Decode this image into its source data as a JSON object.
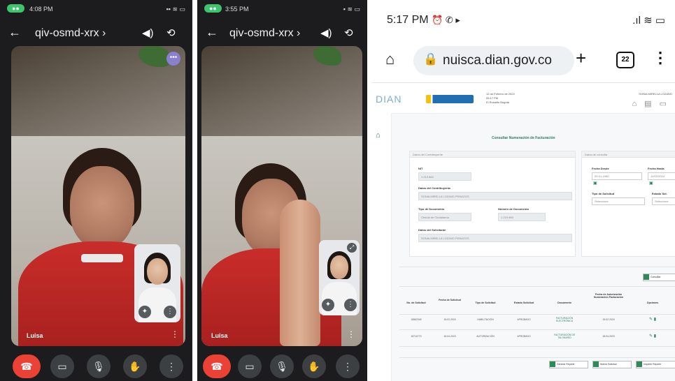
{
  "phone_left": {
    "status_pill": "●●",
    "status_time": "4:08 PM",
    "status_right": "▪▪ ≋ ▭",
    "meeting_code": "qiv-osmd-xrx",
    "meeting_chevron": "›",
    "participant_name": "Luisa",
    "tile_more": "⋮",
    "top_right_badge": "•••"
  },
  "phone_right": {
    "status_pill": "●●",
    "status_time": "3:55 PM",
    "status_right": "▪ ≋ ▭",
    "meeting_code": "qiv-osmd-xrx",
    "meeting_chevron": "›",
    "participant_name": "Luisa",
    "tile_more": "⋮"
  },
  "call_icons": {
    "back": "←",
    "speaker": "◀)",
    "switch_camera": "⟲",
    "end_call": "☎",
    "camera": "▭",
    "mic": "🎙",
    "hand": "✋",
    "more": "⋮",
    "selfview_effects": "✦",
    "selfview_more": "⋮",
    "selfview_expand": "⤢"
  },
  "browser": {
    "time": "5:17 PM",
    "status_icons": "⏰ ✆ ▸",
    "signal": ".ıl ≋ ▭",
    "url": "nuisca.dian.gov.co",
    "tab_count": "22",
    "home_icon": "⌂",
    "lock_icon": "🔒",
    "plus": "+",
    "menu": "⋮"
  },
  "site": {
    "logo": "DIAN",
    "header_date": "12 de Febrero de 2024",
    "header_time": "05:17 PM",
    "header_city": "El Rosalito Bogotá",
    "header_user": "SONIA MIRELLA LOZANO",
    "header_icons": "⌂ ▤ ▭",
    "home_icon": "⌂",
    "page_title": "Consultar Numeración de Facturación",
    "panel1_title": "Datos del Contribuyente",
    "panel2_title": "Datos de consulta",
    "nit_label": "NIT",
    "nit_value": "1 219 860",
    "razon_label": "Datos del Contribuyente",
    "razon_value": "SONIA MIRELLA LOZANO PENAGOS",
    "tipo_doc_label": "Tipo de Documento",
    "tipo_doc_value": "Cédula de Ciudadanía",
    "num_doc_label": "Número de Documento",
    "num_doc_value": "1 219 860",
    "solicitante_label": "Datos del Solicitante",
    "solicitante_value": "SONIA MIRELLA LOZANO PENAGOS",
    "fecha_desde_label": "Fecha Desde",
    "fecha_desde_value": "09-01-1980",
    "fecha_hasta_label": "Fecha Hasta",
    "fecha_hasta_value": "12/02/2024",
    "tipo_sol_label": "Tipo de Solicitud",
    "tipo_sol_value": "Seleccione",
    "estado_label": "Estado Sol.",
    "estado_value": "Seleccione",
    "consultar_btn": "Consultar",
    "table_headers": [
      "No. de Solicitud",
      "Fecha de Solicitud",
      "Tipo de Solicitud",
      "Estado Solicitud",
      "Documento",
      "Fecha de Autorización Numeración Facturación",
      "Opciones"
    ],
    "table_rows": [
      [
        "18562345",
        "15-02-2024",
        "HABILITACIÓN",
        "APROBADO",
        "FACTURACIÓN ELECTRÓNICA",
        "15-02-2024",
        "✎ ▮"
      ],
      [
        "18710770",
        "16-04-2023",
        "AUTORIZACIÓN",
        "APROBADO",
        "FACTURACIÓN DE TALONARIO",
        "18-04-2023",
        "✎ ▮"
      ]
    ],
    "footer_buttons": [
      "Generar Reporte",
      "Nueva Solicitud",
      "Imprimir Reporte"
    ]
  }
}
